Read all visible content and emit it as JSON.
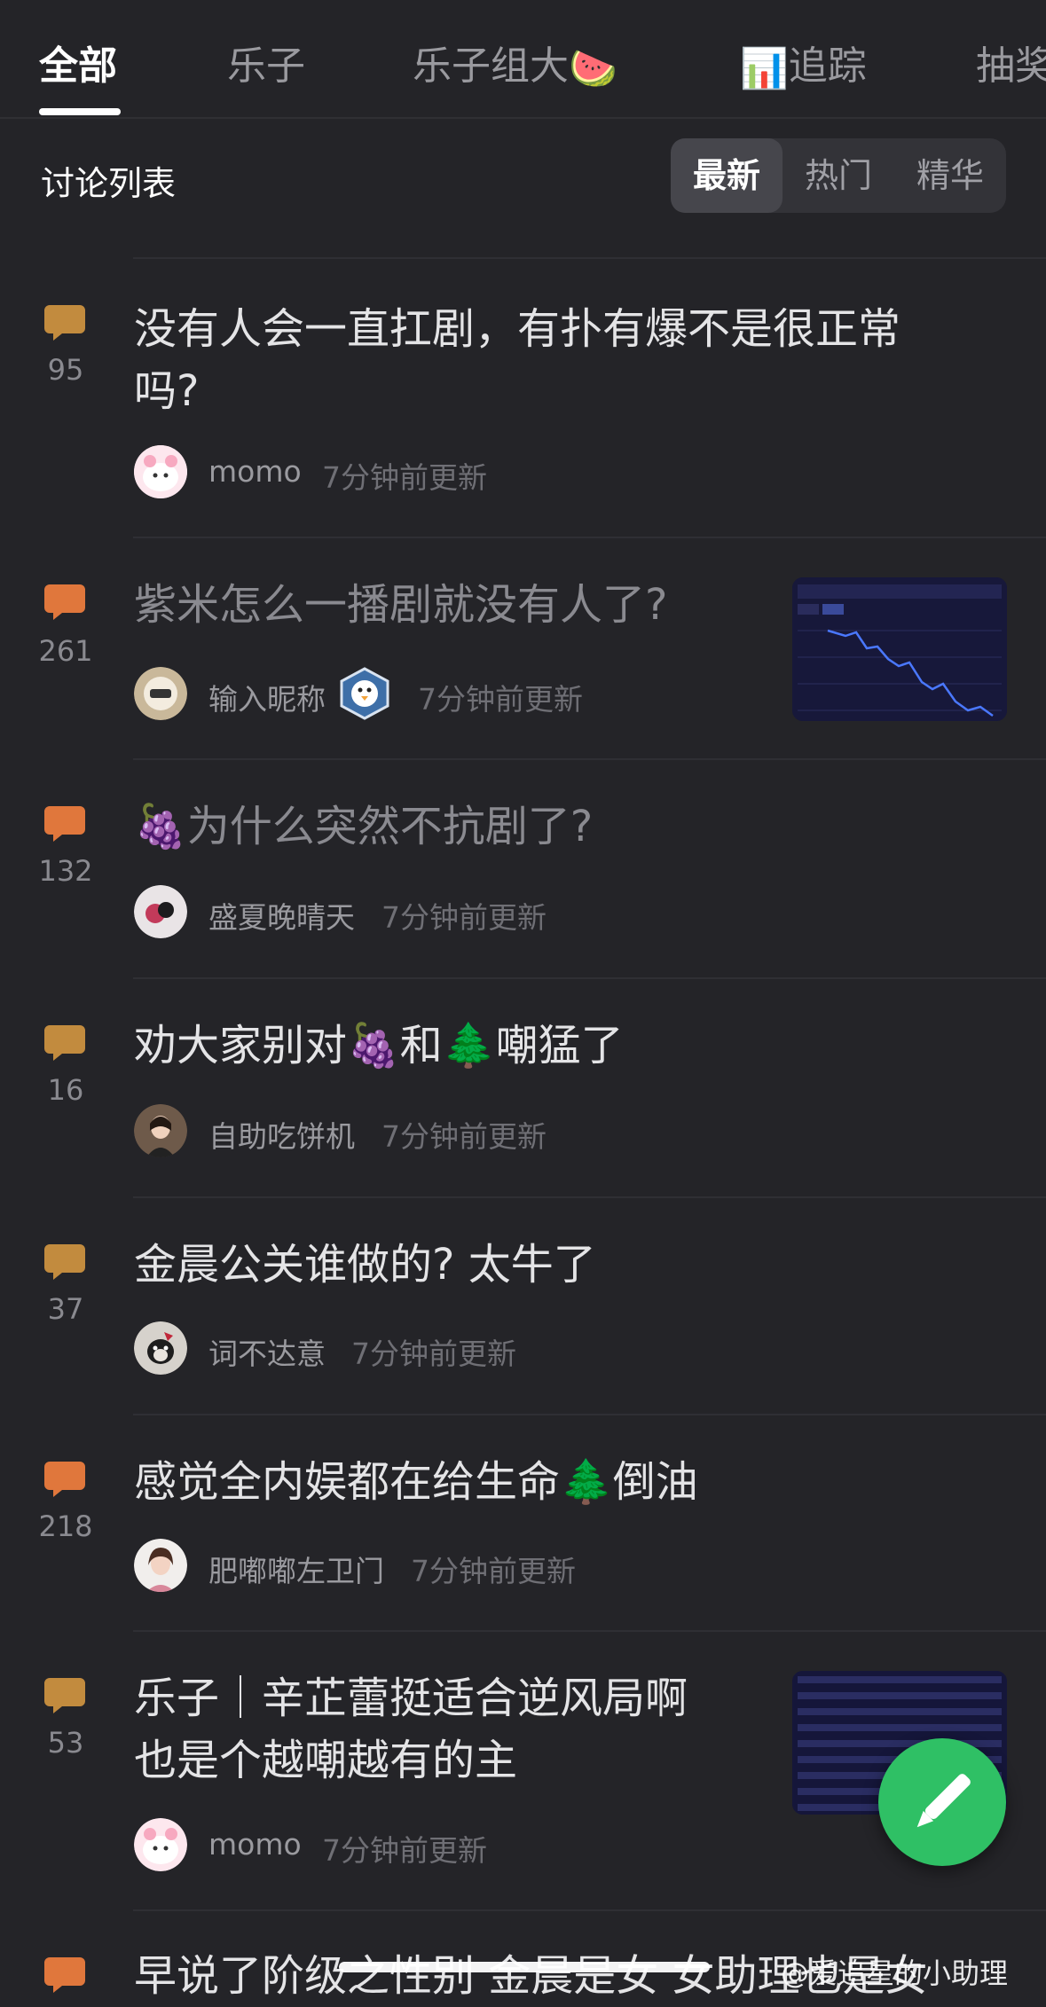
{
  "tabs": [
    {
      "label": "全部",
      "emoji": ""
    },
    {
      "label": "乐子",
      "emoji": ""
    },
    {
      "label": "乐子组大",
      "emoji": "🍉"
    },
    {
      "label": "追踪",
      "emoji": "📊"
    },
    {
      "label": "抽奖",
      "emoji": ""
    }
  ],
  "section_title": "讨论列表",
  "sort": [
    "最新",
    "热门",
    "精华"
  ],
  "posts": [
    {
      "count": "95",
      "title": "没有人会一直扛剧，有扑有爆不是很正常吗?",
      "author": "momo",
      "time": "7分钟前更新"
    },
    {
      "count": "261",
      "title": "紫米怎么一播剧就没有人了?",
      "author": "输入昵称",
      "time": "7分钟前更新"
    },
    {
      "count": "132",
      "title_emoji": "🍇",
      "title": "为什么突然不抗剧了?",
      "author": "盛夏晚晴天",
      "time": "7分钟前更新"
    },
    {
      "count": "16",
      "title_a": "劝大家别对",
      "emoji_a": "🍇",
      "title_b": "和",
      "emoji_b": "🌲",
      "title_c": "嘲猛了",
      "author": "自助吃饼机",
      "time": "7分钟前更新"
    },
    {
      "count": "37",
      "title": "金晨公关谁做的? 太牛了",
      "author": "词不达意",
      "time": "7分钟前更新"
    },
    {
      "count": "218",
      "title": "感觉全内娱都在给生命",
      "emoji": "🌲",
      "title_end": "倒油",
      "author": "肥嘟嘟左卫门",
      "time": "7分钟前更新"
    },
    {
      "count": "53",
      "title_line1": "乐子｜辛芷蕾挺适合逆风局啊",
      "title_line2": "也是个越嘲越有的主",
      "author": "momo",
      "time": "7分钟前更新"
    },
    {
      "title": "早说了阶级之性别 金晨是女 女助理也是女"
    }
  ],
  "watermark": "@爱追星的小助理",
  "colors": {
    "accent_orange": "#e0773c",
    "accent_brown": "#c28b3e",
    "fab_green": "#2fc065"
  }
}
